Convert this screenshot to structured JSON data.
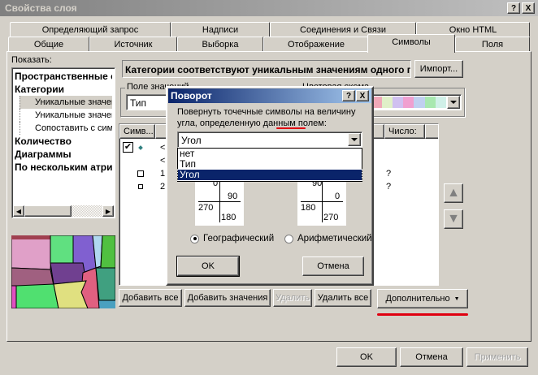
{
  "window": {
    "title": "Свойства слоя",
    "help": "?",
    "close": "X"
  },
  "tabs_row1": [
    "Определяющий запрос",
    "Надписи",
    "Соединения и Связи",
    "Окно HTML"
  ],
  "tabs_row2": [
    "Общие",
    "Источник",
    "Выборка",
    "Отображение",
    "Символы",
    "Поля"
  ],
  "active_tab": "Символы",
  "show_label": "Показать:",
  "tree": [
    {
      "label": "Пространственные с",
      "bold": true
    },
    {
      "label": "Категории",
      "bold": true
    },
    {
      "label": "Уникальные значени",
      "selected": true
    },
    {
      "label": "Уникальные значени"
    },
    {
      "label": "Сопоставить с симв"
    },
    {
      "label": "Количество",
      "bold": true
    },
    {
      "label": "Диаграммы",
      "bold": true
    },
    {
      "label": "По нескольким атри",
      "bold": true
    }
  ],
  "description": "Категории соответствуют уникальным значениям одного п",
  "import_button": "Импорт...",
  "value_field": {
    "label": "Поле значений",
    "value": "Тип"
  },
  "color_scheme": {
    "label": "Цветовая схема",
    "colors": [
      "#c8f0d8",
      "#f0a8b8",
      "#e0f0c8",
      "#d0c0f0",
      "#f0a0d0",
      "#c0d0f0",
      "#a8e8b0",
      "#d0f0e8"
    ]
  },
  "table": {
    "headers": [
      "Симв...",
      "",
      "Число:"
    ],
    "rows": [
      {
        "checked": true,
        "symbol": "dot",
        "value": "<",
        "count": ""
      },
      {
        "symbol": "",
        "value": "<",
        "count": ""
      },
      {
        "symbol": "square",
        "value": "1",
        "count": "?"
      },
      {
        "symbol": "small-square",
        "value": "2",
        "count": "?"
      }
    ]
  },
  "buttons": {
    "add_all": "Добавить все",
    "add_values": "Добавить значения",
    "remove": "Удалить",
    "remove_all": "Удалить все",
    "advanced": "Дополнительно"
  },
  "footer": {
    "ok": "OK",
    "cancel": "Отмена",
    "apply": "Применить"
  },
  "rotation_dialog": {
    "title": "Поворот",
    "help": "?",
    "close": "X",
    "prompt_line1": "Повернуть точечные символы на величину",
    "prompt_line2_a": "угла, определенную данным ",
    "prompt_line2_b": "полем",
    "prompt_line2_c": ":",
    "field_value": "Угол",
    "options": [
      "нет",
      "Тип",
      "Угол"
    ],
    "selected_option": "Угол",
    "geo_diagram": {
      "top": "0",
      "right": "90",
      "left": "270",
      "bottom": "180"
    },
    "arith_diagram": {
      "top": "90",
      "right": "0",
      "left": "180",
      "bottom": "270"
    },
    "radio_geographic": "Географический",
    "radio_arithmetic": "Арифметический",
    "selected_radio": "Географический",
    "ok": "OK",
    "cancel": "Отмена"
  }
}
